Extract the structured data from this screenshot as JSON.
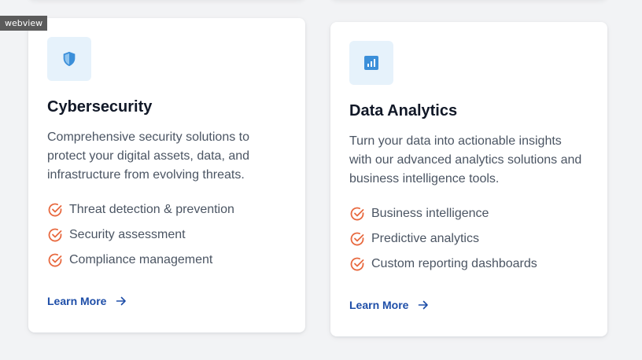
{
  "overlay": {
    "webview_label": "webview"
  },
  "cards": [
    {
      "icon": "shield-icon",
      "title": "Cybersecurity",
      "description": "Comprehensive security solutions to protect your digital assets, data, and infrastructure from evolving threats.",
      "features": [
        "Threat detection & prevention",
        "Security assessment",
        "Compliance management"
      ],
      "link_label": "Learn More"
    },
    {
      "icon": "bar-chart-icon",
      "title": "Data Analytics",
      "description": "Turn your data into actionable insights with our advanced analytics solutions and business intelligence tools.",
      "features": [
        "Business intelligence",
        "Predictive analytics",
        "Custom reporting dashboards"
      ],
      "link_label": "Learn More"
    }
  ],
  "colors": {
    "accent_orange": "#e8693f",
    "icon_blue": "#3b8fd9",
    "link_blue": "#1e4ea8",
    "icon_background": "#e6f2fb"
  }
}
